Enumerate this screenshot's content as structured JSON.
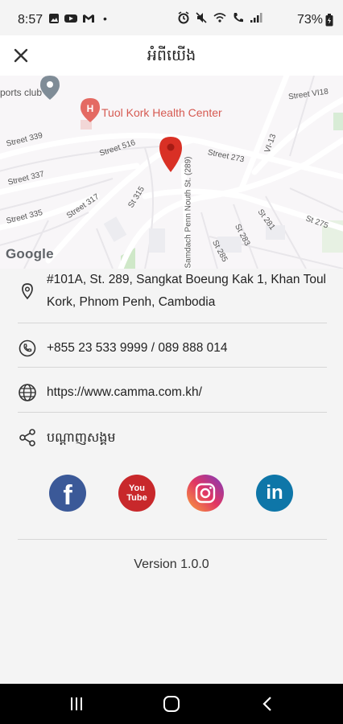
{
  "status": {
    "time": "8:57",
    "battery": "73%"
  },
  "header": {
    "title": "អំពីយើង"
  },
  "map": {
    "labels": {
      "sports_club": "ports club",
      "health_center": "Tuol Kork Health Center",
      "street_339": "Street 339",
      "street_337": "Street 337",
      "street_335": "Street 335",
      "street_317": "Street 317",
      "street_516": "Street 516",
      "st_315": "St 315",
      "street_273": "Street 273",
      "vi13": "VI-13",
      "street_vi18": "Street VI18",
      "samdach": "Samdach Penn Nouth St. (289)",
      "st_281": "St 281",
      "st_283": "St 283",
      "st_285": "St 285",
      "st_275": "St 275"
    },
    "google_logo": "Google"
  },
  "info": {
    "address": "#101A, St. 289, Sangkat Boeung Kak 1, Khan Toul Kork, Phnom Penh, Cambodia",
    "phone": "+855 23 533 9999 / 089 888 014",
    "website": "https://www.camma.com.kh/",
    "social_heading": "បណ្តាញសង្គម"
  },
  "socials": [
    {
      "name": "Facebook",
      "glyph": "f",
      "color": "#3b5998"
    },
    {
      "name": "YouTube",
      "glyph": "You Tube",
      "color": "#d12b2b"
    },
    {
      "name": "Instagram",
      "glyph": "",
      "color": "#c13584"
    },
    {
      "name": "LinkedIn",
      "glyph": "in",
      "color": "#0e76a8"
    }
  ],
  "footer": {
    "version": "Version 1.0.0"
  }
}
